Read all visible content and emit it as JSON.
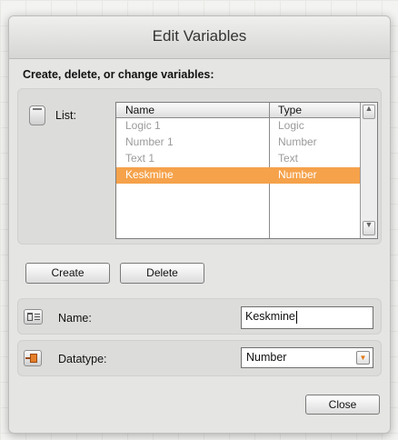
{
  "dialog": {
    "title": "Edit Variables",
    "section_label": "Create, delete, or change variables:"
  },
  "list": {
    "label": "List:",
    "columns": [
      "Name",
      "Type"
    ],
    "rows": [
      {
        "name": "Logic 1",
        "type": "Logic",
        "selected": false
      },
      {
        "name": "Number 1",
        "type": "Number",
        "selected": false
      },
      {
        "name": "Text 1",
        "type": "Text",
        "selected": false
      },
      {
        "name": "Keskmine",
        "type": "Number",
        "selected": true
      }
    ],
    "scroll_up_icon": "triangle-up-icon",
    "scroll_down_icon": "triangle-down-icon"
  },
  "buttons": {
    "create_label": "Create",
    "delete_label": "Delete",
    "close_label": "Close"
  },
  "name_field": {
    "label": "Name:",
    "value": "Keskmine",
    "icon": "text-field-icon"
  },
  "datatype_field": {
    "label": "Datatype:",
    "value": "Number",
    "icon": "datatype-icon"
  },
  "colors": {
    "selection": "#f5a24b",
    "accent_arrow": "#e07818"
  }
}
